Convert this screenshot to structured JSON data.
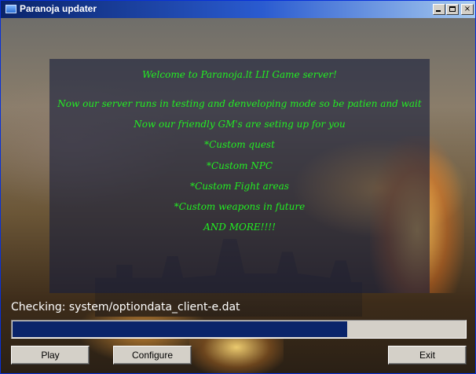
{
  "window": {
    "title": "Paranoja updater",
    "controls": {
      "minimize": "minimize",
      "maximize": "maximize",
      "close": "×"
    }
  },
  "message": {
    "lines": [
      "Welcome to Paranoja.lt LII Game server!",
      "Now our server runs in testing and denveloping mode so be patien and wait",
      "Now our friendly GM's are seting up for you",
      "*Custom quest",
      "*Custom NPC",
      "*Custom Fight areas",
      "*Custom weapons in future",
      "AND MORE!!!!"
    ],
    "color": "#22ee22"
  },
  "status": {
    "text": "Checking: system/optiondata_client-e.dat"
  },
  "progress": {
    "fraction": 0.74,
    "fill_color": "#0a246a"
  },
  "buttons": {
    "play": "Play",
    "configure": "Configure",
    "exit": "Exit"
  }
}
